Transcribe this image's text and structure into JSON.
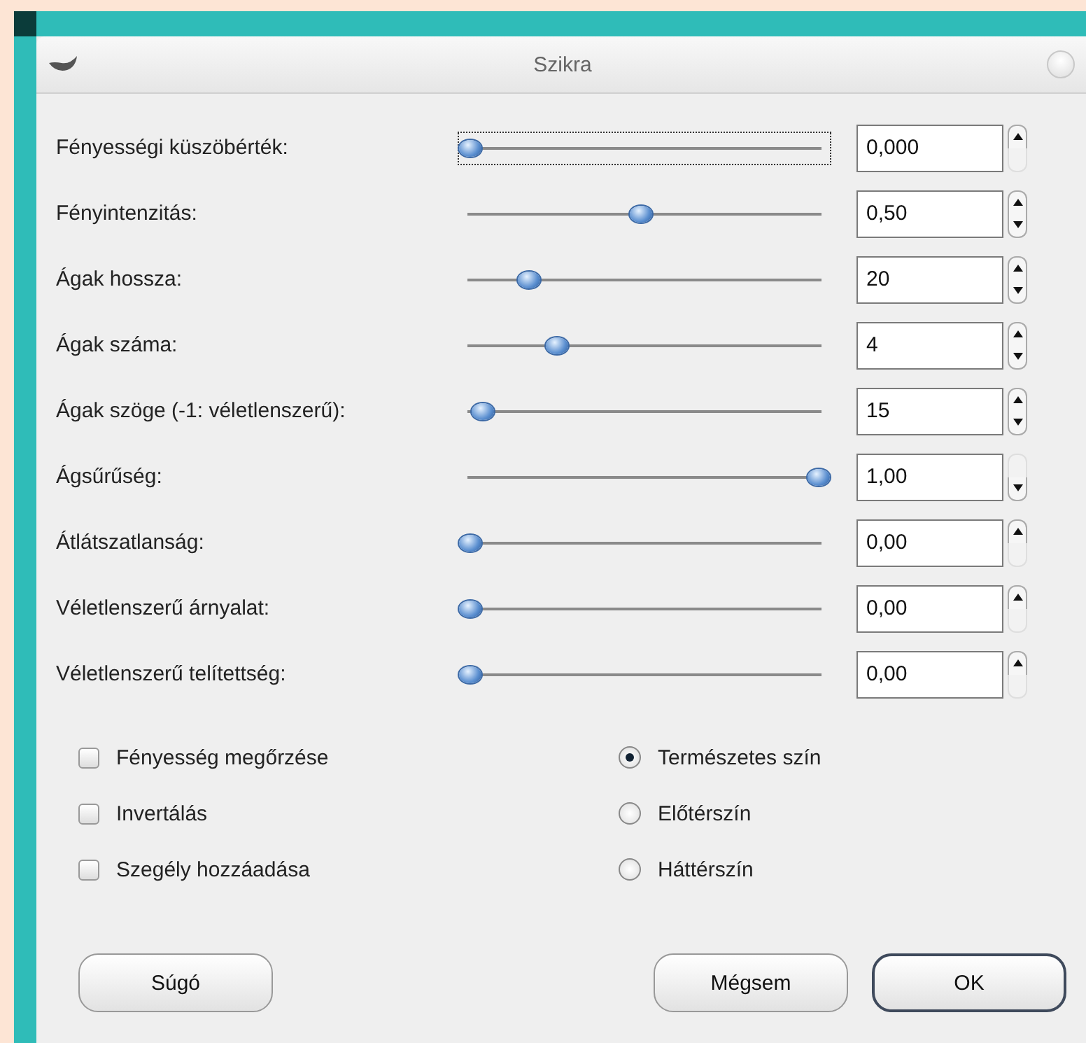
{
  "window": {
    "title": "Szikra"
  },
  "rows": [
    {
      "label": "Fényességi küszöbérték:",
      "level": 0,
      "value": "0,000",
      "focused": true,
      "up_disabled": false,
      "down_disabled": true
    },
    {
      "label": "Fényintenzitás:",
      "level": 0.49,
      "value": "0,50",
      "focused": false,
      "up_disabled": false,
      "down_disabled": false
    },
    {
      "label": "Ágak hossza:",
      "level": 0.17,
      "value": "20",
      "focused": false,
      "up_disabled": false,
      "down_disabled": false
    },
    {
      "label": "Ágak száma:",
      "level": 0.25,
      "value": "4",
      "focused": false,
      "up_disabled": false,
      "down_disabled": false
    },
    {
      "label": "Ágak szöge (-1: véletlenszerű):",
      "level": 0.035,
      "value": "15",
      "focused": false,
      "up_disabled": false,
      "down_disabled": false
    },
    {
      "label": "Ágsűrűség:",
      "level": 1,
      "value": "1,00",
      "focused": false,
      "up_disabled": true,
      "down_disabled": false
    },
    {
      "label": "Átlátszatlanság:",
      "level": 0,
      "value": "0,00",
      "focused": false,
      "up_disabled": false,
      "down_disabled": true
    },
    {
      "label": "Véletlenszerű árnyalat:",
      "level": 0,
      "value": "0,00",
      "focused": false,
      "up_disabled": false,
      "down_disabled": true
    },
    {
      "label": "Véletlenszerű telítettség:",
      "level": 0,
      "value": "0,00",
      "focused": false,
      "up_disabled": false,
      "down_disabled": true
    }
  ],
  "checkboxes": [
    {
      "label": "Fényesség megőrzése",
      "checked": false
    },
    {
      "label": "Invertálás",
      "checked": false
    },
    {
      "label": "Szegély hozzáadása",
      "checked": false
    }
  ],
  "radios": [
    {
      "label": "Természetes szín",
      "selected": true
    },
    {
      "label": "Előtérszín",
      "selected": false
    },
    {
      "label": "Háttérszín",
      "selected": false
    }
  ],
  "buttons": [
    {
      "label": "Súgó",
      "kind": "help"
    },
    {
      "label": "Mégsem",
      "kind": "normal"
    },
    {
      "label": "OK",
      "kind": "default"
    }
  ]
}
